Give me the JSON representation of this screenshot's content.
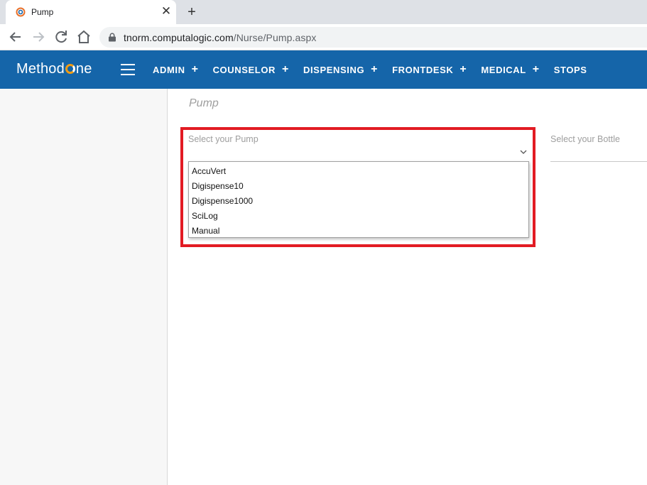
{
  "browser": {
    "tab_title": "Pump",
    "new_tab_symbol": "+",
    "close_symbol": "✕",
    "url_domain": "tnorm.computalogic.com",
    "url_path": "/Nurse/Pump.aspx"
  },
  "app": {
    "logo_prefix": "Method",
    "logo_suffix": "ne",
    "menu": [
      {
        "label": "ADMIN",
        "plus": "+"
      },
      {
        "label": "COUNSELOR",
        "plus": "+"
      },
      {
        "label": "DISPENSING",
        "plus": "+"
      },
      {
        "label": "FRONTDESK",
        "plus": "+"
      },
      {
        "label": "MEDICAL",
        "plus": "+"
      },
      {
        "label": "STOPS"
      }
    ],
    "accent_color": "#1565a9",
    "logo_accent": "#f39c12"
  },
  "page": {
    "title": "Pump",
    "pump_select": {
      "label": "Select your Pump",
      "options": [
        "AccuVert",
        "Digispense10",
        "Digispense1000",
        "SciLog",
        "Manual"
      ]
    },
    "bottle_select": {
      "label": "Select your Bottle"
    },
    "highlight_color": "#e21b23"
  }
}
